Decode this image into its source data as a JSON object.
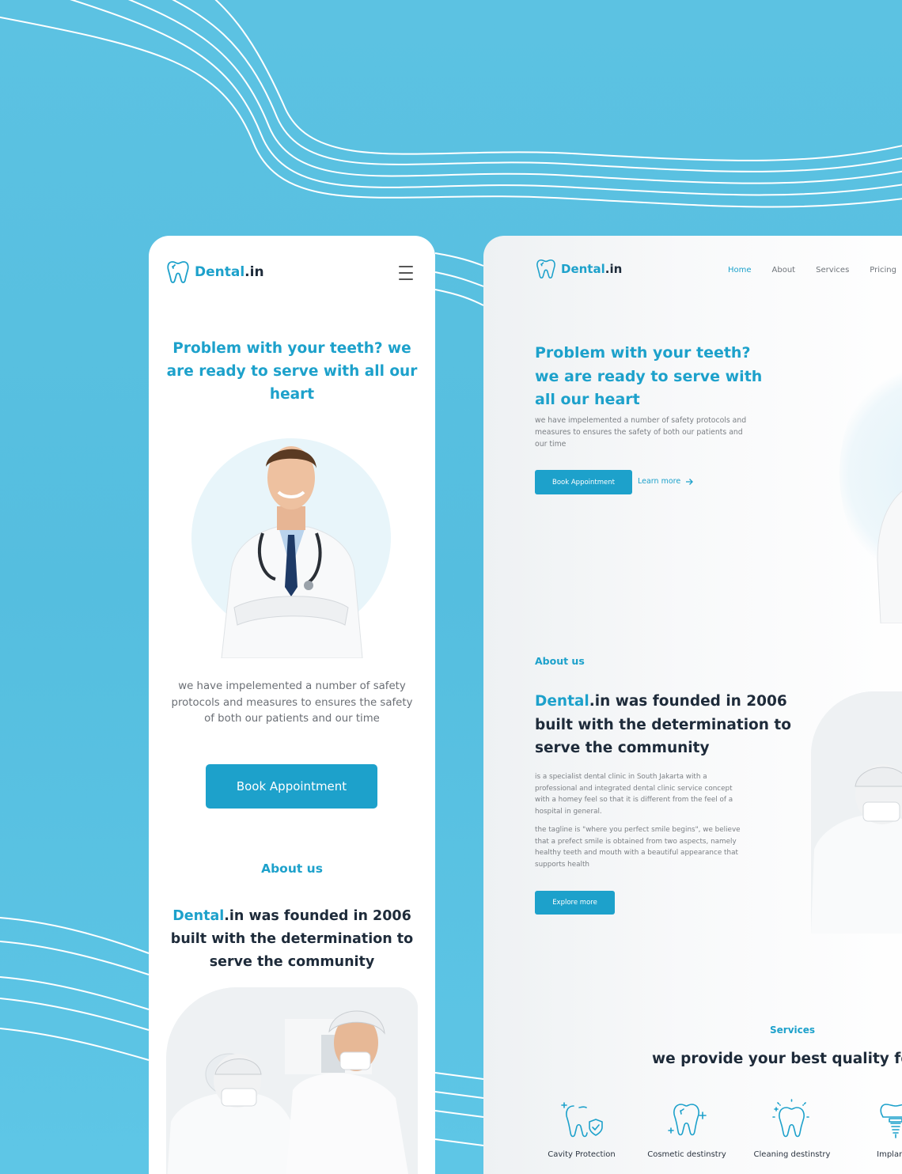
{
  "brand": {
    "name_accent": "Dental",
    "name_rest": ".in"
  },
  "colors": {
    "accent": "#1da1cb",
    "dark": "#1e2b3a",
    "background": "#5cc2e2"
  },
  "mobile": {
    "menu_icon": "hamburger-menu-icon",
    "hero_title": "Problem with your teeth? we are ready to serve with all our heart",
    "hero_desc": "we have impelemented a number of safety protocols and measures to ensures the safety of both our patients and our time",
    "book_button": "Book Appointment",
    "about_label": "About us",
    "about_title_accent": "Dental",
    "about_title_rest": ".in was founded in 2006 built with the determination to serve the community"
  },
  "desktop": {
    "nav": [
      "Home",
      "About",
      "Services",
      "Pricing"
    ],
    "hero_title": "Problem with your teeth? we are ready to serve with all our heart",
    "hero_desc": "we have impelemented a number of safety protocols and measures to ensures the safety of both our patients and our time",
    "book_button": "Book Appointment",
    "learn_more": "Learn more",
    "about_label": "About us",
    "about_title_accent": "Dental",
    "about_title_rest": ".in was founded in 2006 built with the determination to serve the community",
    "about_p1": "is a specialist dental clinic in South Jakarta with a professional and integrated dental clinic service concept with a homey feel so that it is different from the feel of a hospital in general.",
    "about_p2": "the tagline is \"where you perfect smile begins\", we believe that a prefect smile is obtained from two aspects, namely healthy teeth and mouth with a beautiful appearance that supports health",
    "explore_button": "Explore more",
    "services_label": "Services",
    "services_title": "we provide your best quality for",
    "services": [
      {
        "label": "Cavity Protection",
        "icon": "tooth-shield-icon"
      },
      {
        "label": "Cosmetic destinstry",
        "icon": "tooth-sparkle-icon"
      },
      {
        "label": "Cleaning destinstry",
        "icon": "tooth-clean-icon"
      },
      {
        "label": "Implant d",
        "icon": "tooth-implant-icon"
      }
    ]
  }
}
